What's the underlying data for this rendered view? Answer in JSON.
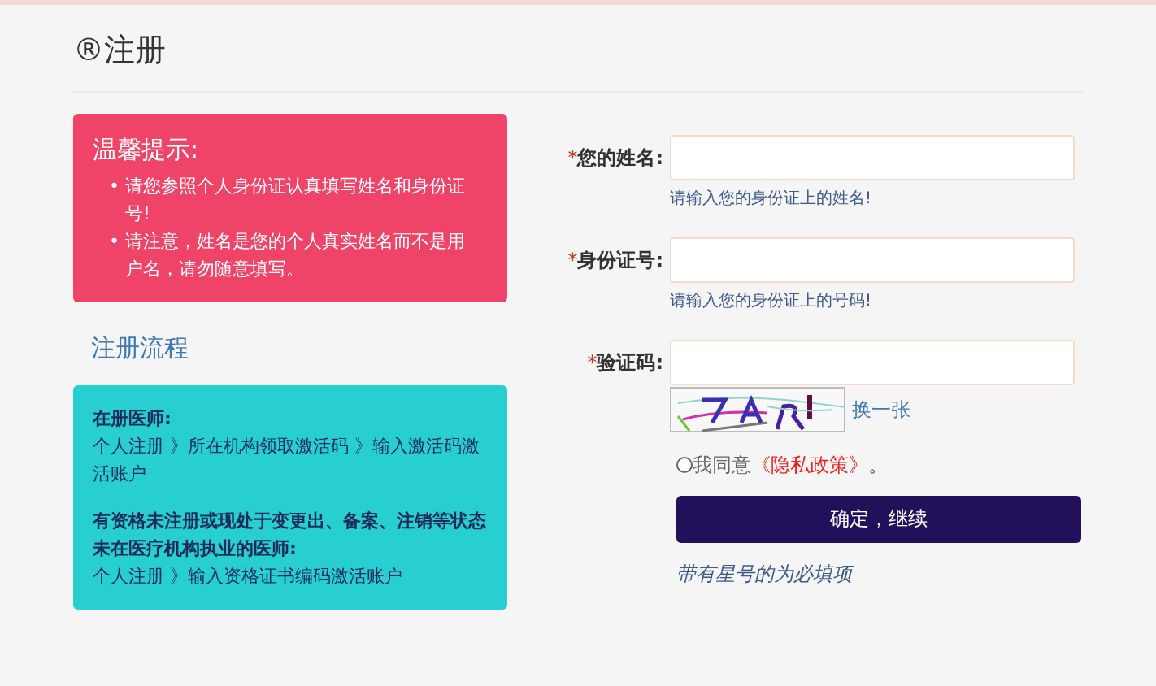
{
  "page_title": "®注册",
  "tips": {
    "title": "温馨提示:",
    "items": [
      {
        "bullet": "•",
        "text": "请您参照个人身份证认真填写姓名和身份证号!"
      },
      {
        "bullet": "•",
        "text": "请注意，姓名是您的个人真实姓名而不是用户名，请勿随意填写。"
      }
    ]
  },
  "process": {
    "title": "注册流程",
    "groups": [
      {
        "heading": "在册医师:",
        "steps": "个人注册 》所在机构领取激活码 》输入激活码激活账户"
      },
      {
        "heading": "有资格未注册或现处于变更出、备案、注销等状态未在医疗机构执业的医师:",
        "steps": "个人注册 》输入资格证书编码激活账户"
      }
    ]
  },
  "form": {
    "fields": [
      {
        "kind": "text",
        "required_mark": "*",
        "label": "您的姓名:",
        "hint": "请输入您的身份证上的姓名!"
      },
      {
        "kind": "text",
        "required_mark": "*",
        "label": "身份证号:",
        "hint": "请输入您的身份证上的号码!"
      },
      {
        "kind": "captcha",
        "required_mark": "*",
        "label": "验证码:",
        "refresh_link": "换一张"
      }
    ],
    "agree": {
      "checked": false,
      "text": "我同意",
      "link": "《隐私政策》",
      "suffix": "。"
    },
    "submit": "确定，继续",
    "note": "带有星号的为必填项"
  }
}
